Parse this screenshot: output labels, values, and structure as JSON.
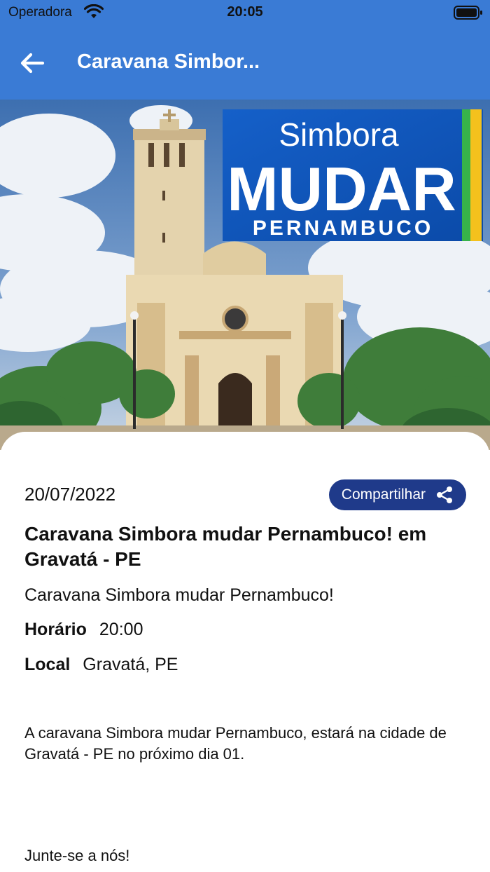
{
  "status_bar": {
    "carrier": "Operadora",
    "time": "20:05"
  },
  "appbar": {
    "title": "Caravana Simbor...",
    "back_icon": "arrow-left-icon",
    "color": "#3a7bd5"
  },
  "hero": {
    "logo_line1": "Simbora",
    "logo_line2": "MUDAR",
    "logo_line3": "PERNAMBUCO"
  },
  "event": {
    "date": "20/07/2022",
    "share_label": "Compartilhar",
    "share_icon": "share-icon",
    "title": "Caravana Simbora mudar Pernambuco! em Gravatá - PE",
    "subtitle": "Caravana Simbora mudar Pernambuco!",
    "time_label": "Horário",
    "time_value": "20:00",
    "place_label": "Local",
    "place_value": "Gravatá, PE",
    "description": "A caravana Simbora mudar Pernambuco, estará na cidade de Gravatá - PE no próximo dia 01.",
    "closing": "Junte-se a nós!",
    "button_color": "#1f3a8a"
  }
}
